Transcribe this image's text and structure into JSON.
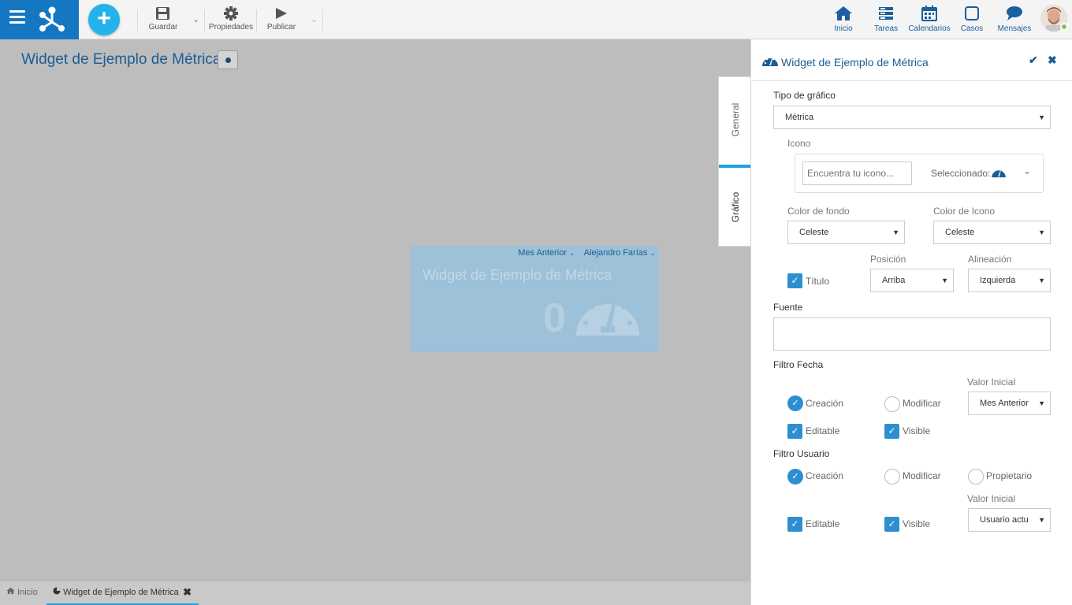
{
  "topbar": {
    "save_label": "Guardar",
    "properties_label": "Propiedades",
    "publish_label": "Publicar",
    "nav": {
      "home": "Inicio",
      "tasks": "Tareas",
      "calendars": "Calendarios",
      "cases": "Casos",
      "messages": "Mensajes"
    }
  },
  "canvas": {
    "title": "Widget de Ejemplo de Métrica",
    "widget": {
      "filter_date": "Mes Anterior",
      "filter_user": "Alejandro Farías",
      "title": "Widget de Ejemplo de Métrica",
      "value": "0"
    }
  },
  "side_tabs": {
    "general": "General",
    "grafico": "Gráfico"
  },
  "panel": {
    "title": "Widget de Ejemplo de Métrica",
    "chart_type_label": "Tipo de gráfico",
    "chart_type_value": "Métrica",
    "icon_label": "Icono",
    "icon_search_placeholder": "Encuentra tu icono...",
    "icon_selected_label": "Seleccionado:",
    "bg_color_label": "Color de fondo",
    "bg_color_value": "Celeste",
    "icon_color_label": "Color de Icono",
    "icon_color_value": "Celeste",
    "title_check_label": "Título",
    "position_label": "Posición",
    "position_value": "Arriba",
    "alignment_label": "Alineación",
    "alignment_value": "Izquierda",
    "source_label": "Fuente",
    "source_value": "",
    "date_filter": {
      "label": "Filtro Fecha",
      "creation": "Creación",
      "modify": "Modificar",
      "initial_value_label": "Valor Inicial",
      "initial_value": "Mes Anterior",
      "editable": "Editable",
      "visible": "Visible"
    },
    "user_filter": {
      "label": "Filtro Usuario",
      "creation": "Creación",
      "modify": "Modificar",
      "owner": "Propietario",
      "initial_value_label": "Valor Inicial",
      "initial_value": "Usuario actu",
      "editable": "Editable",
      "visible": "Visible"
    }
  },
  "bottom_tabs": {
    "home": "Inicio",
    "widget": "Widget de Ejemplo de Métrica"
  },
  "colors": {
    "brand": "#1577c2",
    "accent": "#1fa0e3",
    "check": "#2d8fd1"
  }
}
